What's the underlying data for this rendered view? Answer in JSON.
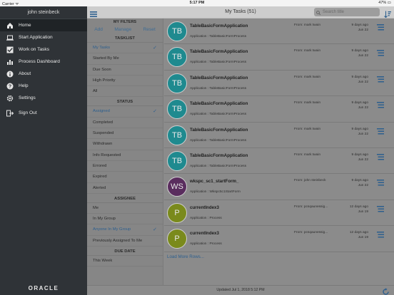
{
  "status_bar": {
    "carrier": "Carrier ᯤ",
    "time": "5:17 PM",
    "battery": "47% ▭"
  },
  "sidebar": {
    "user": "john steinbeck",
    "items": [
      {
        "label": "Home",
        "icon": "home-icon"
      },
      {
        "label": "Start Application",
        "icon": "laptop-icon"
      },
      {
        "label": "Work on Tasks",
        "icon": "checkbox-icon"
      },
      {
        "label": "Process Dashboard",
        "icon": "bar-chart-icon"
      },
      {
        "label": "About",
        "icon": "info-icon"
      },
      {
        "label": "Help",
        "icon": "help-icon"
      },
      {
        "label": "Settings",
        "icon": "gear-icon"
      },
      {
        "label": "Sign Out",
        "icon": "sign-out-icon"
      }
    ],
    "footer_logo": "ORACLE"
  },
  "header": {
    "title": "My Tasks (51)",
    "search_placeholder": "Search title"
  },
  "filters": {
    "title": "MY FILTERS",
    "add": "Add",
    "manage": "Manage",
    "reset": "Reset",
    "tasklist_title": "TASKLIST",
    "tasklist": [
      "My Tasks",
      "Started By Me",
      "Due Soon",
      "High Priority",
      "All"
    ],
    "status_title": "STATUS",
    "status": [
      "Assigned",
      "Completed",
      "Suspended",
      "Withdrawn",
      "Info Requested",
      "Errored",
      "Expired",
      "Alerted"
    ],
    "assignee_title": "ASSIGNEE",
    "assignee": [
      "Me",
      "In My Group",
      "Anyone In My Group",
      "Previously Assigned To Me"
    ],
    "due_title": "DUE DATE",
    "due": [
      "This Week"
    ],
    "check": "✓"
  },
  "tasks": [
    {
      "initials": "TB",
      "name": "TableBasicFormApplication",
      "app_label": "Application :",
      "app": "TableBasicFormProcess",
      "from": "From: mark twain",
      "ago": "9 days ago",
      "date": "Jun 22",
      "color": "#1f8a8f"
    },
    {
      "initials": "TB",
      "name": "TableBasicFormApplication",
      "app_label": "Application :",
      "app": "TableBasicFormProcess",
      "from": "From: mark twain",
      "ago": "9 days ago",
      "date": "Jun 22",
      "color": "#1f8a8f"
    },
    {
      "initials": "TB",
      "name": "TableBasicFormApplication",
      "app_label": "Application :",
      "app": "TableBasicFormProcess",
      "from": "From: mark twain",
      "ago": "9 days ago",
      "date": "Jun 22",
      "color": "#1f8a8f"
    },
    {
      "initials": "TB",
      "name": "TableBasicFormApplication",
      "app_label": "Application :",
      "app": "TableBasicFormProcess",
      "from": "From: mark twain",
      "ago": "9 days ago",
      "date": "Jun 22",
      "color": "#1f8a8f"
    },
    {
      "initials": "TB",
      "name": "TableBasicFormApplication",
      "app_label": "Application :",
      "app": "TableBasicFormProcess",
      "from": "From: mark twain",
      "ago": "9 days ago",
      "date": "Jun 22",
      "color": "#1f8a8f"
    },
    {
      "initials": "TB",
      "name": "TableBasicFormApplication",
      "app_label": "Application :",
      "app": "TableBasicFormProcess",
      "from": "From: mark twain",
      "ago": "9 days ago",
      "date": "Jun 22",
      "color": "#1f8a8f"
    },
    {
      "initials": "WS",
      "name": "wkspc_sc1_startForm_",
      "app_label": "Application :",
      "app": "Wkspc5c1StartForm",
      "from": "From: john steinbeck",
      "ago": "9 days ago",
      "date": "Jun 22",
      "color": "#5a2d5e"
    },
    {
      "initials": "P",
      "name": "currentIndex3",
      "app_label": "Application :",
      "app": "Process",
      "from": "From: pcsqaunessig...",
      "ago": "12 days ago",
      "date": "Jun 19",
      "color": "#7a8a1c"
    },
    {
      "initials": "P",
      "name": "currentIndex3",
      "app_label": "Application :",
      "app": "Process",
      "from": "From: pcsqaunessig...",
      "ago": "12 days ago",
      "date": "Jun 19",
      "color": "#7a8a1c"
    }
  ],
  "load_more": "Load More Rows...",
  "footer": {
    "updated": "Updated Jul 1, 2018 5:12 PM"
  },
  "colors": {
    "accent": "#2d5f8e",
    "sidebar_bg": "#2f3337"
  }
}
